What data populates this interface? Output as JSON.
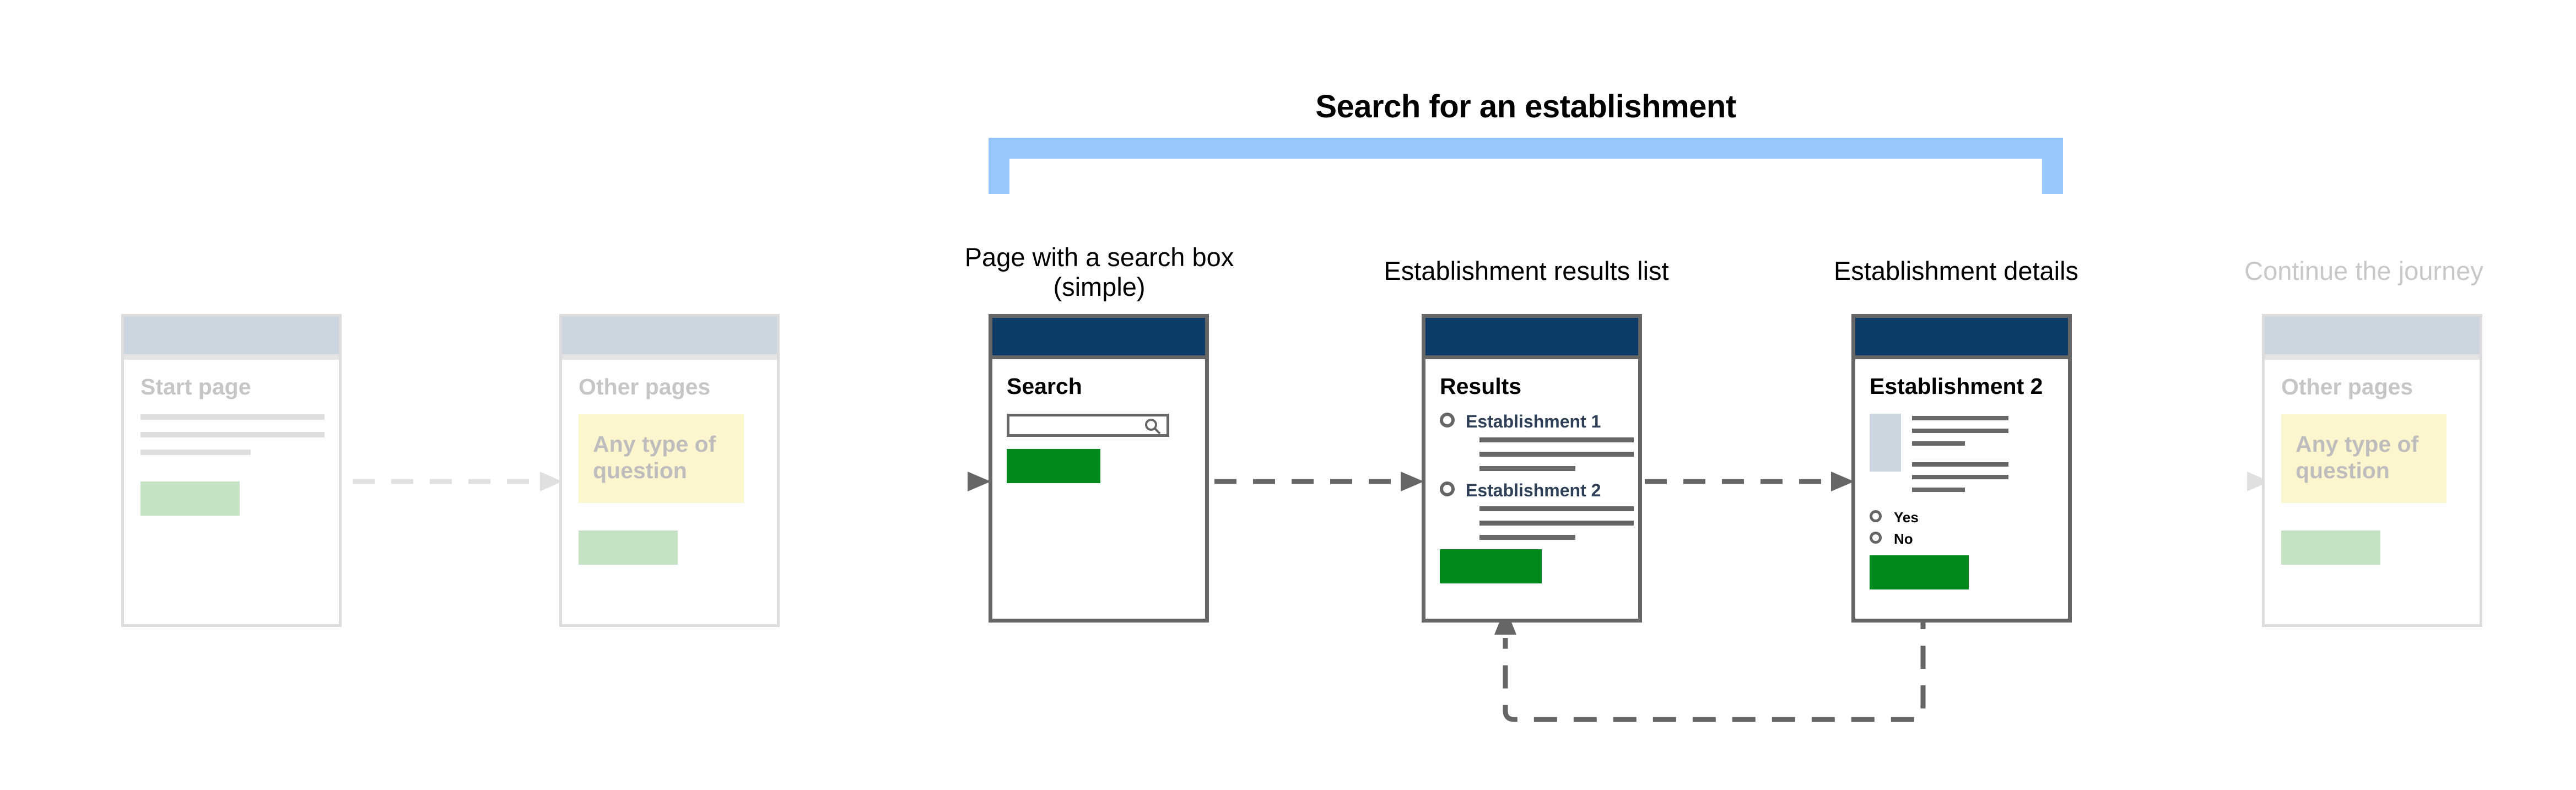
{
  "diagram": {
    "section_title": "Search for an establishment",
    "scope_bracket_color": "#9ac7fb"
  },
  "cards": [
    {
      "label": "",
      "state": "faded",
      "heading": "Start page",
      "content_type": "text-lines",
      "lines": [
        "",
        "",
        ""
      ],
      "button": "",
      "button_color": "#c5e2c5"
    },
    {
      "label": "",
      "state": "faded",
      "heading": "Other pages",
      "content_type": "question-block",
      "question": "Any type of\nquestion",
      "question_bg": "#fdf5cd",
      "button": "",
      "button_color": "#c5e2c5"
    },
    {
      "label": "Page with a search box\n(simple)",
      "state": "active",
      "heading": "Search",
      "content_type": "search-box",
      "search_placeholder": "",
      "search_value": "",
      "search_icon": "magnifier-icon",
      "button": "",
      "button_color": "#018a1b",
      "header_color": "#0d3c68"
    },
    {
      "label": "Establishment results list",
      "state": "active",
      "heading": "Results",
      "content_type": "results-list",
      "results": [
        {
          "name": "Establishment 1",
          "selected": false
        },
        {
          "name": "Establishment 2",
          "selected": false
        }
      ],
      "button": "",
      "button_color": "#018a1b",
      "header_color": "#0d3c68"
    },
    {
      "label": "Establishment details",
      "state": "active",
      "heading": "Establishment 2",
      "content_type": "detail-view",
      "thumbnail": "image-placeholder",
      "radios": [
        {
          "label": "Yes",
          "selected": false
        },
        {
          "label": "No",
          "selected": false
        }
      ],
      "button": "",
      "button_color": "#018a1b",
      "header_color": "#0d3c68"
    },
    {
      "label": "Continue the journey",
      "state": "faded",
      "heading": "Other pages",
      "content_type": "question-block",
      "question": "Any type of\nquestion",
      "question_bg": "#fdf5cd",
      "button": "",
      "button_color": "#c5e2c5"
    }
  ],
  "connectors": [
    {
      "from": "start-page",
      "to": "other-pages",
      "style": "dashed",
      "tone": "faded"
    },
    {
      "from": "other-pages",
      "to": "search-page",
      "style": "dashed",
      "tone": "fade-in"
    },
    {
      "from": "search-page",
      "to": "results-list",
      "style": "dashed",
      "tone": "dark"
    },
    {
      "from": "results-list",
      "to": "establishment-details",
      "style": "dashed",
      "tone": "dark"
    },
    {
      "from": "establishment-details",
      "to": "continue-journey",
      "style": "dashed",
      "tone": "fade-out"
    },
    {
      "from": "establishment-details",
      "to": "results-list",
      "style": "dashed",
      "tone": "dark",
      "shape": "loopback"
    }
  ]
}
